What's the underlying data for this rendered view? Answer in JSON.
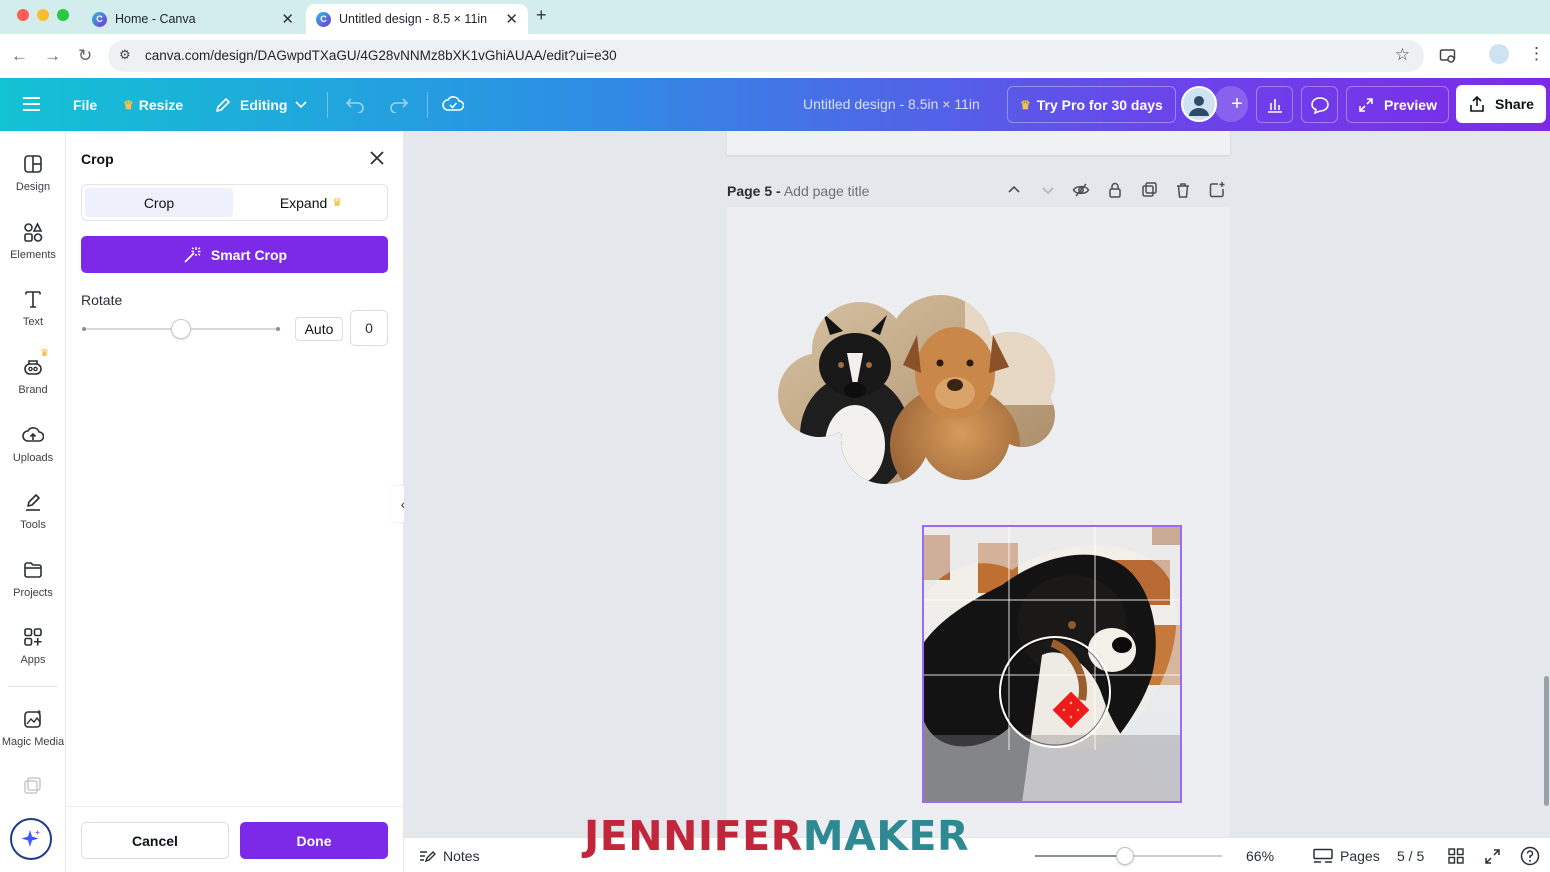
{
  "browser": {
    "tabs": [
      {
        "title": "Home - Canva",
        "active": false
      },
      {
        "title": "Untitled design - 8.5 × 11in",
        "active": true
      }
    ],
    "url": "canva.com/design/DAGwpdTXaGU/4G28vNNMz8bXK1vGhiAUAA/edit?ui=e30"
  },
  "header": {
    "file": "File",
    "resize": "Resize",
    "editing": "Editing",
    "design_title": "Untitled design - 8.5in × 11in",
    "try_pro": "Try Pro for 30 days",
    "preview": "Preview",
    "share": "Share",
    "colors": {
      "gradient_start": "#13c2d3",
      "gradient_end": "#7c2ae8"
    }
  },
  "rail": {
    "items": [
      {
        "label": "Design",
        "icon": "design-icon"
      },
      {
        "label": "Elements",
        "icon": "elements-icon"
      },
      {
        "label": "Text",
        "icon": "text-icon"
      },
      {
        "label": "Brand",
        "icon": "brand-icon"
      },
      {
        "label": "Uploads",
        "icon": "uploads-icon"
      },
      {
        "label": "Tools",
        "icon": "tools-icon"
      },
      {
        "label": "Projects",
        "icon": "projects-icon"
      },
      {
        "label": "Apps",
        "icon": "apps-icon"
      },
      {
        "label": "Magic Media",
        "icon": "magic-media-icon"
      }
    ]
  },
  "crop_panel": {
    "title": "Crop",
    "tab_crop": "Crop",
    "tab_expand": "Expand",
    "smart_crop": "Smart Crop",
    "rotate_label": "Rotate",
    "rotate_auto": "Auto",
    "rotate_value": "0",
    "rotate_slider_fraction": 0.5,
    "cancel": "Cancel",
    "done": "Done",
    "accent": "#7d2ae8"
  },
  "canvas": {
    "page_label": "Page 5 -",
    "page_title_placeholder": "Add page title"
  },
  "bottom": {
    "notes": "Notes",
    "zoom": "66%",
    "zoom_fraction": 0.48,
    "pages": "Pages",
    "page_count": "5 / 5"
  },
  "watermark": {
    "part1": "JENNIFER",
    "part2": "MAKER",
    "color1": "#c2263a",
    "color2": "#2d8a93"
  }
}
